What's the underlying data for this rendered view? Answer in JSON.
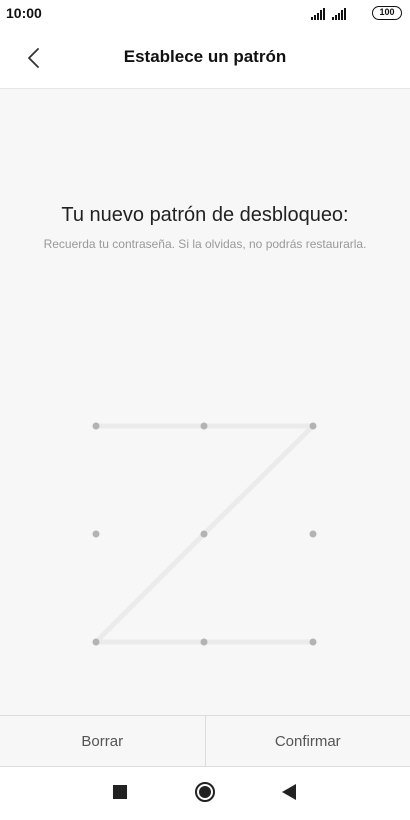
{
  "status_bar": {
    "time": "10:00",
    "battery": "100"
  },
  "header": {
    "title": "Establece un patrón",
    "back_icon": "chevron-left-icon"
  },
  "main": {
    "headline": "Tu nuevo patrón de desbloqueo:",
    "subtext": "Recuerda tu contraseña. Si la olvidas, no podrás restaurarla.",
    "pattern": {
      "grid": "3x3",
      "selected_sequence": [
        1,
        2,
        3,
        5,
        7,
        8,
        9
      ],
      "line_color": "#ebebeb",
      "dot_color": "#b3b3b3"
    }
  },
  "actions": {
    "clear_label": "Borrar",
    "confirm_label": "Confirmar"
  },
  "nav_bar": {
    "recents_icon": "square-icon",
    "home_icon": "circle-icon",
    "back_icon": "triangle-back-icon"
  }
}
